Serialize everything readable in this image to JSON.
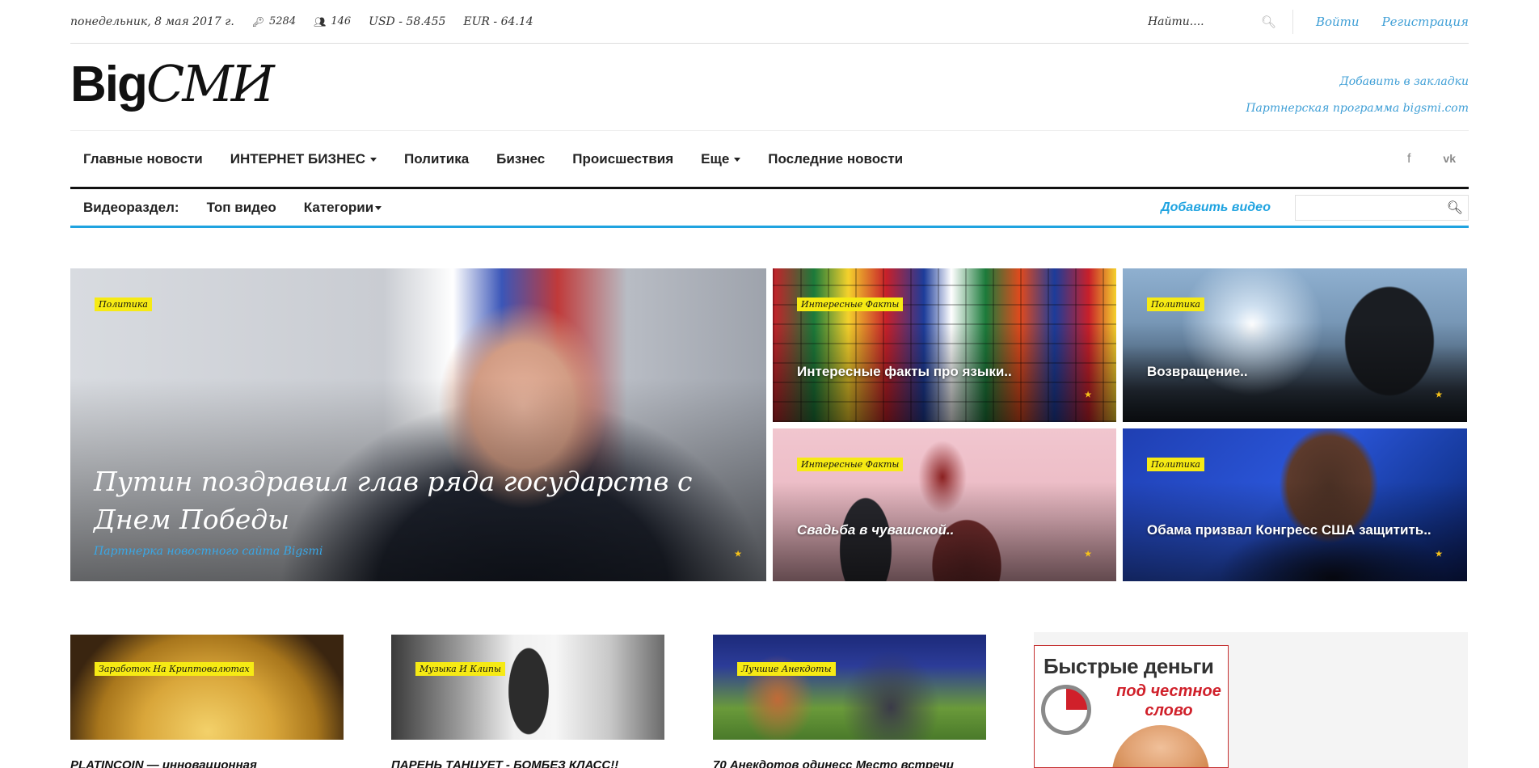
{
  "topbar": {
    "date": "понедельник, 8 мая 2017 г.",
    "keys_count": "5284",
    "users_count": "146",
    "usd": "USD - 58.455",
    "eur": "EUR - 64.14",
    "search_placeholder": "Найти....",
    "login": "Войти",
    "register": "Регистрация"
  },
  "logo": {
    "part1": "Big",
    "part2": "СМИ"
  },
  "logo_links": {
    "bookmark": "Добавить в закладки",
    "partner": "Партнерская программа bigsmi.com"
  },
  "mainnav": {
    "items": [
      "Главные новости",
      "ИНТЕРНЕТ БИЗНЕС",
      "Политика",
      "Бизнес",
      "Происшествия",
      "Еще",
      "Последние новости"
    ]
  },
  "videonav": {
    "label": "Видеораздел:",
    "top": "Топ видео",
    "categories": "Категории",
    "add": "Добавить видео"
  },
  "featured": {
    "big": {
      "badge": "Политика",
      "title": "Путин поздравил глав ряда государств с Днем Победы",
      "subtitle": "Партнерка новостного сайта Bigsmi"
    },
    "t1": {
      "badge": "Интересные Факты",
      "title": "Интересные факты про языки.."
    },
    "t2": {
      "badge": "Политика",
      "title": "Возвращение.."
    },
    "t3": {
      "badge": "Интересные Факты",
      "title": "Свадьба в чувашской.."
    },
    "t4": {
      "badge": "Политика",
      "title": "Обама призвал Конгресс США защитить.."
    }
  },
  "cards": [
    {
      "badge": "Заработок На Криптовалютах",
      "title": "PLATINCOIN — инновационная"
    },
    {
      "badge": "Музыка И Клипы",
      "title": "ПАРЕНЬ ТАНЦУЕТ - БОМБЕЗ КЛАСС!!"
    },
    {
      "badge": "Лучшие Анекдоты",
      "title": "70 Анекдотов одинесс Место встречи"
    }
  ],
  "ad": {
    "line1": "Быстрые деньги",
    "line2": "под честное слово"
  },
  "colors": {
    "accent": "#1fa3e0",
    "link": "#3f9fd6",
    "badge": "#f6ea14",
    "share": "#f6c21a"
  }
}
